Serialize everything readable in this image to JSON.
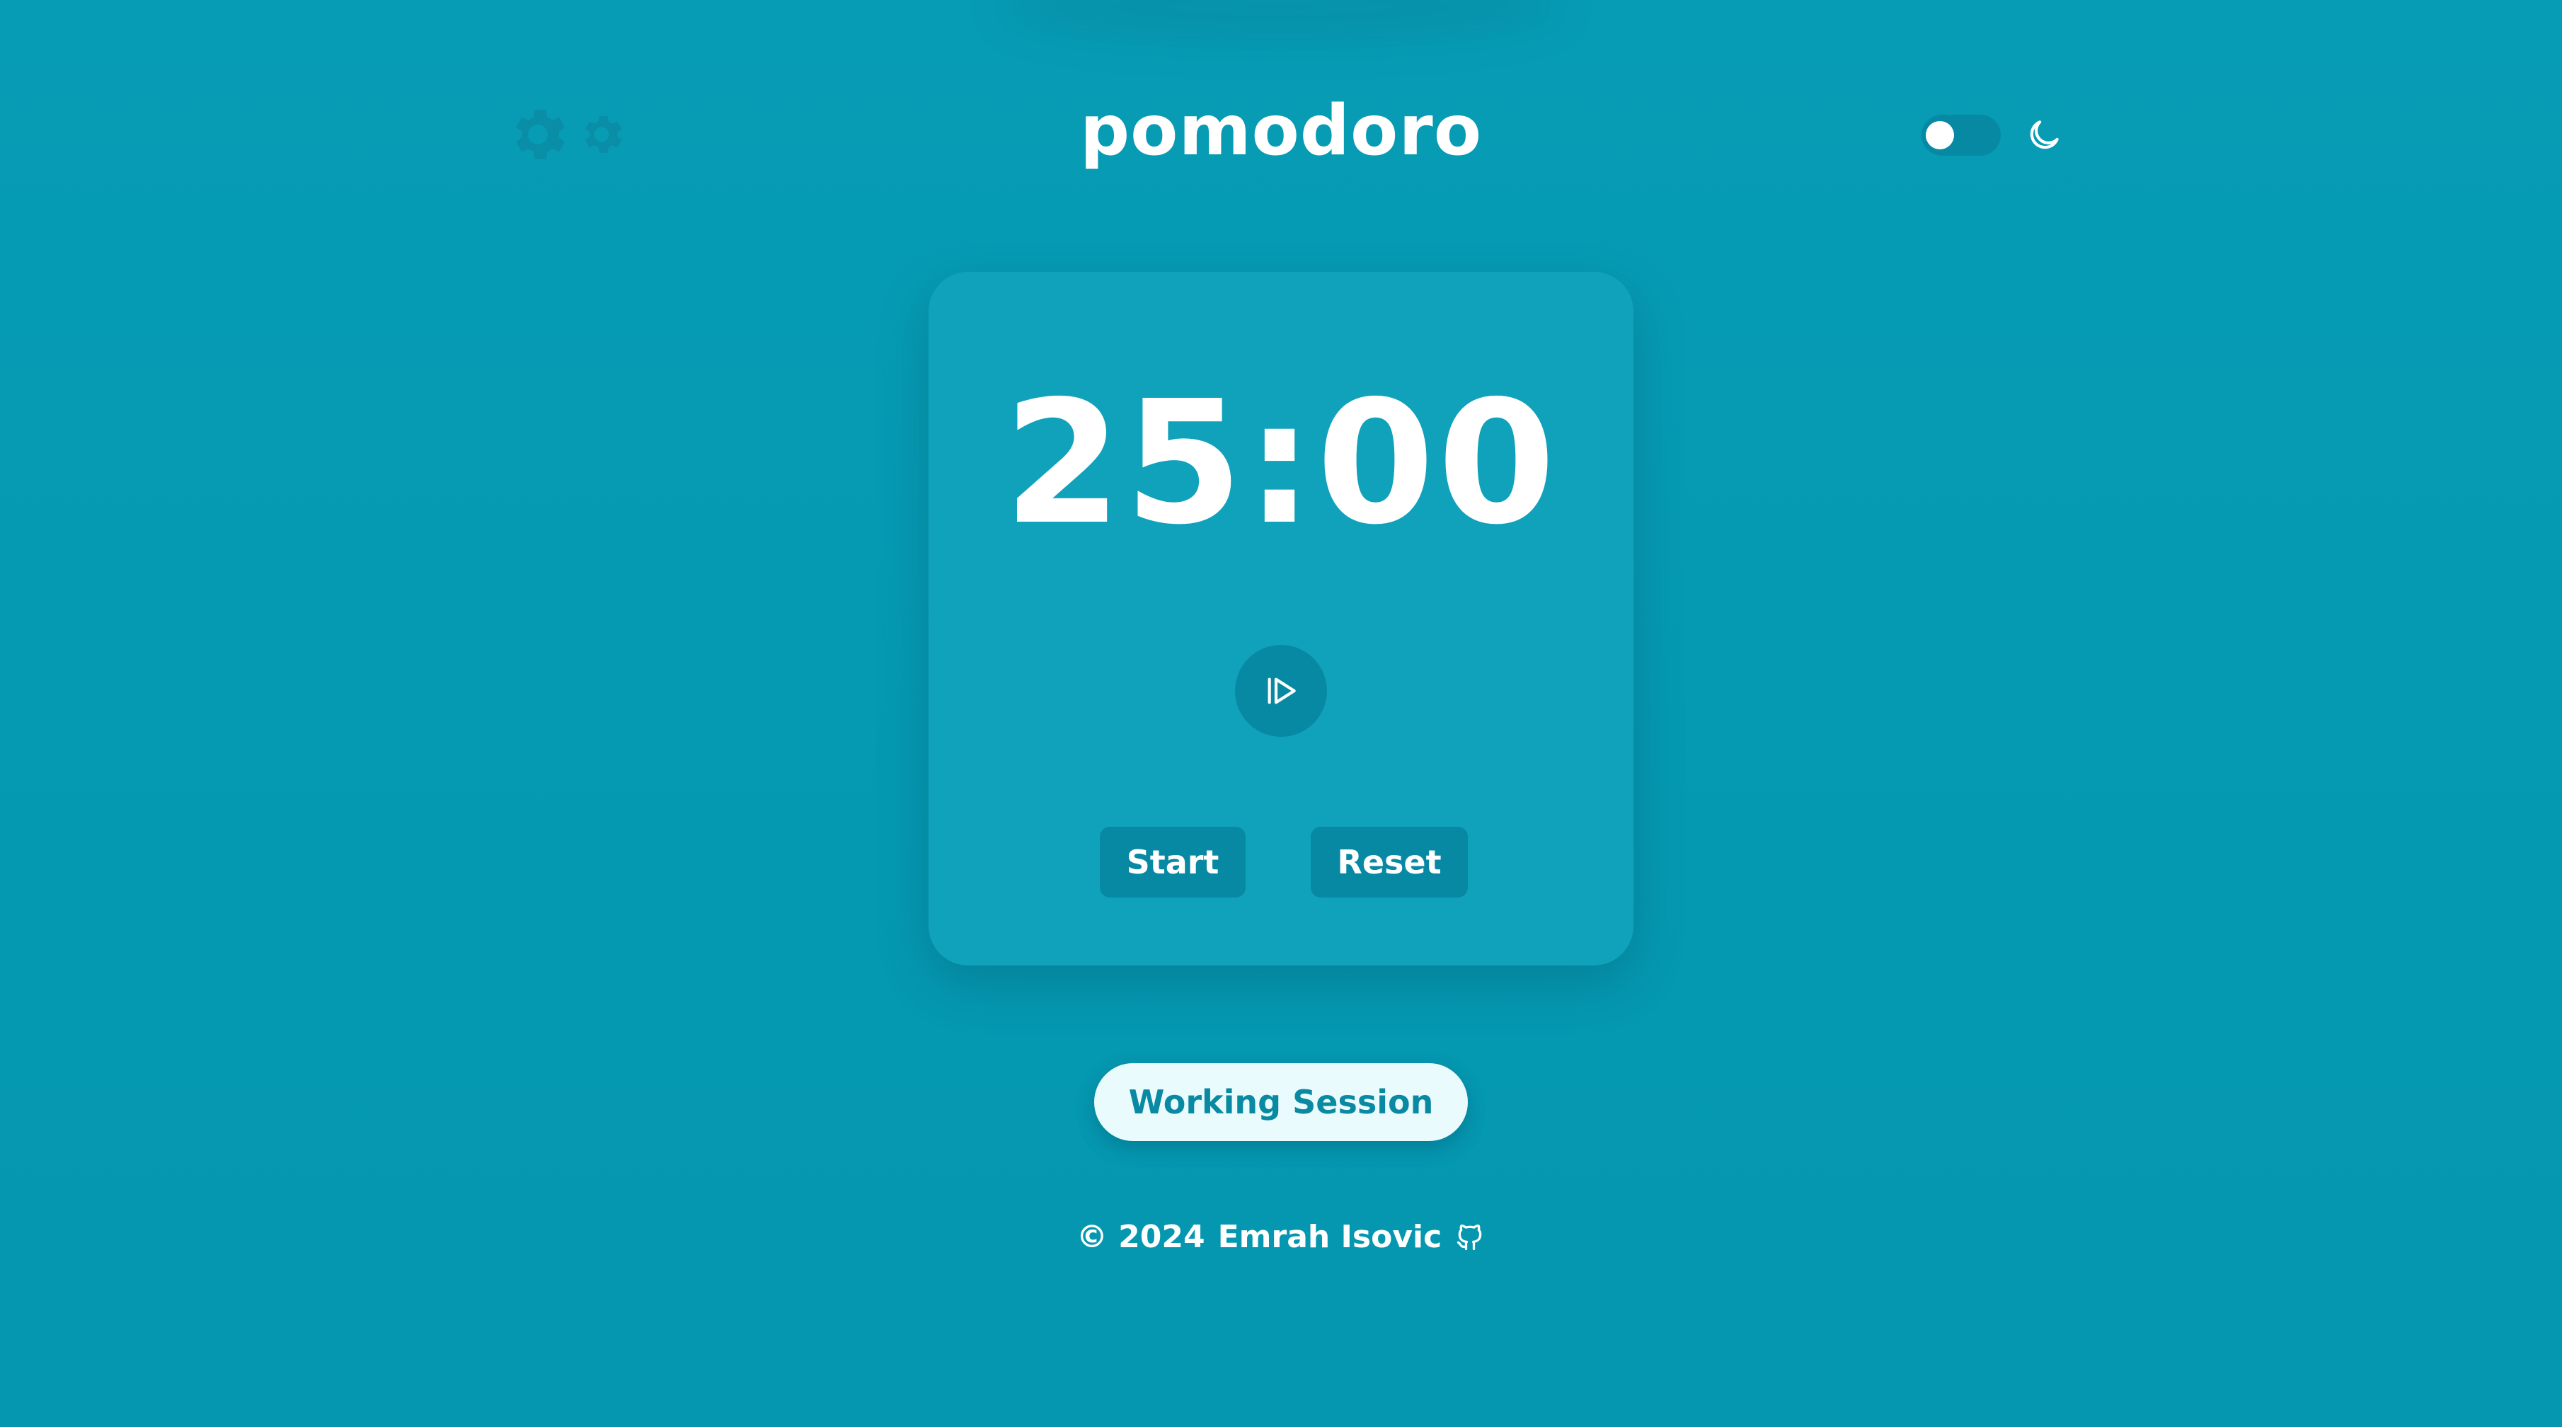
{
  "app": {
    "title": "pomodoro"
  },
  "header": {
    "settings_icons": [
      "gear-icon",
      "gear-icon"
    ],
    "theme_toggle": {
      "state": "off",
      "icon": "moon-icon"
    }
  },
  "timer": {
    "display": "25:00",
    "play_icon": "play-icon",
    "start_label": "Start",
    "reset_label": "Reset"
  },
  "session": {
    "label": "Working Session"
  },
  "footer": {
    "copyright": "© 2024",
    "author": "Emrah Isovic",
    "icon": "github-icon"
  },
  "colors": {
    "background": "#079cb5",
    "card": "#11a2bb",
    "button": "#0889a3",
    "pill_bg": "#e9fbfd",
    "pill_text": "#0a8aa2",
    "text": "#ffffff"
  }
}
